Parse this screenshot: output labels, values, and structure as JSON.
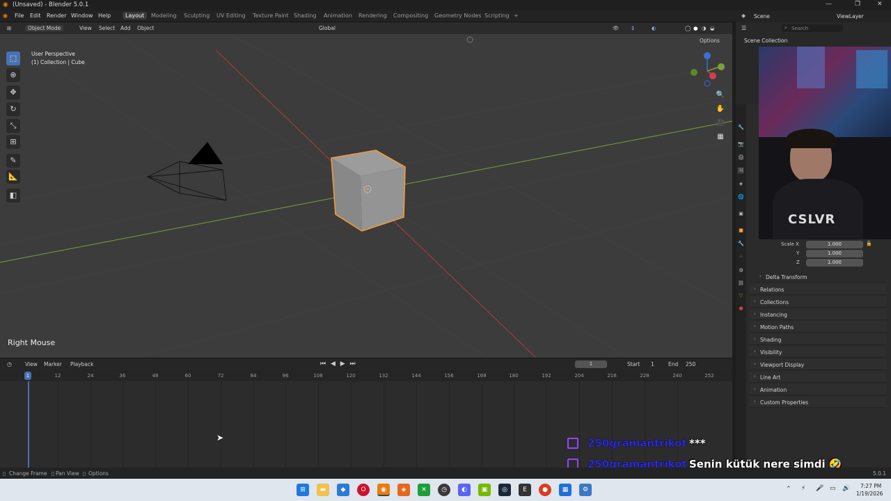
{
  "window": {
    "title": "(Unsaved) - Blender 5.0.1",
    "controls": [
      "—",
      "❐",
      "✕"
    ]
  },
  "menu": {
    "items": [
      "File",
      "Edit",
      "Render",
      "Window",
      "Help"
    ],
    "workspaces": [
      "Layout",
      "Modeling",
      "Sculpting",
      "UV Editing",
      "Texture Paint",
      "Shading",
      "Animation",
      "Rendering",
      "Compositing",
      "Geometry Nodes",
      "Scripting"
    ],
    "add_tab": "+",
    "scene": "Scene",
    "view_layer": "ViewLayer"
  },
  "viewport_header": {
    "mode": "Object Mode",
    "menus": [
      "View",
      "Select",
      "Add",
      "Object"
    ],
    "orientation": "Global",
    "options": "Options"
  },
  "viewport": {
    "perspective": "User Perspective",
    "collection": "(1) Collection | Cube",
    "last_op": "Right Mouse"
  },
  "timeline": {
    "menus": [
      "View",
      "Marker",
      "Playback"
    ],
    "current_frame": "1",
    "start_label": "Start",
    "start": "1",
    "end_label": "End",
    "end": "250",
    "ticks": [
      "1",
      "12",
      "24",
      "36",
      "48",
      "60",
      "72",
      "84",
      "96",
      "108",
      "120",
      "132",
      "144",
      "156",
      "168",
      "180",
      "192",
      "204",
      "216",
      "228",
      "240",
      "252"
    ]
  },
  "outliner": {
    "search_placeholder": "Search",
    "root": "Scene Collection"
  },
  "properties": {
    "scale_label": "Scale X",
    "scale_x": "1.000",
    "y_label": "Y",
    "scale_y": "1.000",
    "z_label": "Z",
    "scale_z": "1.000",
    "delta": "Delta Transform",
    "panels": [
      "Relations",
      "Collections",
      "Instancing",
      "Motion Paths",
      "Shading",
      "Visibility",
      "Viewport Display",
      "Line Art",
      "Animation",
      "Custom Properties"
    ]
  },
  "statusbar": {
    "items": [
      "Change Frame",
      "Pan View",
      "Options"
    ],
    "version": "5.0.1"
  },
  "chat": [
    {
      "user": "250gramantrikot",
      "message": "***"
    },
    {
      "user": "250gramantrikot",
      "message": "Senin kütük nere şimdi 🤣"
    }
  ],
  "webcam_text": "CSLVR",
  "taskbar": {
    "time": "7:27 PM",
    "date": "1/19/2026"
  },
  "colors": {
    "selection": "#f29a38",
    "active": "#4772b3",
    "x_axis": "#b33b3b",
    "y_axis": "#7aa33b",
    "twitch": "#9146ff"
  }
}
